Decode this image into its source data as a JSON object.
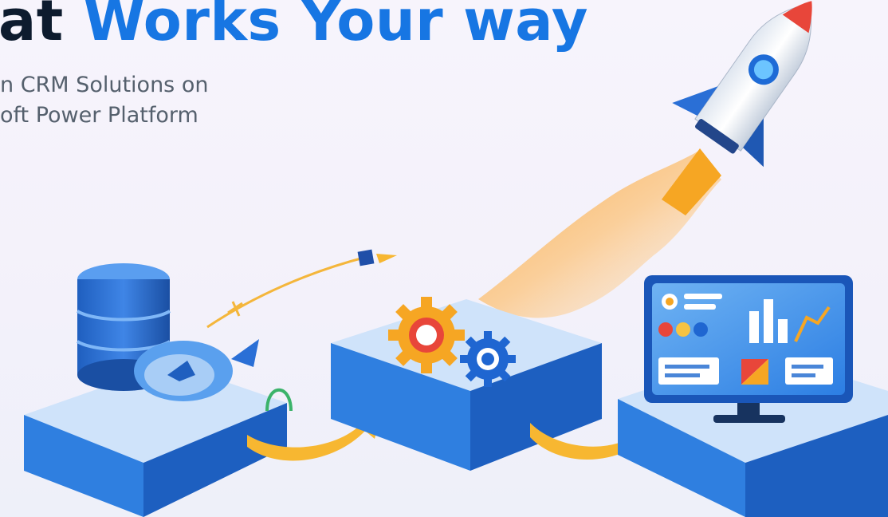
{
  "hero": {
    "headline_dark": "at",
    "headline_blue": "Works Your way",
    "subtitle_line1": "n CRM Solutions on",
    "subtitle_line2": "oft Power Platform"
  },
  "illustration": {
    "icons": [
      "database-icon",
      "fish-icon",
      "gears-icon",
      "monitor-dashboard-icon",
      "rocket-icon",
      "paper-plane-icon",
      "curved-arrow-icon"
    ]
  },
  "colors": {
    "headline_dark": "#0d1b2e",
    "headline_blue": "#1776e3",
    "subtitle": "#55606d",
    "platform_top": "#cfe3fa",
    "platform_side": "#2f7fe0",
    "arrow": "#f7b731",
    "rocket_nose": "#e8463a",
    "flame": "#f9c56a"
  }
}
